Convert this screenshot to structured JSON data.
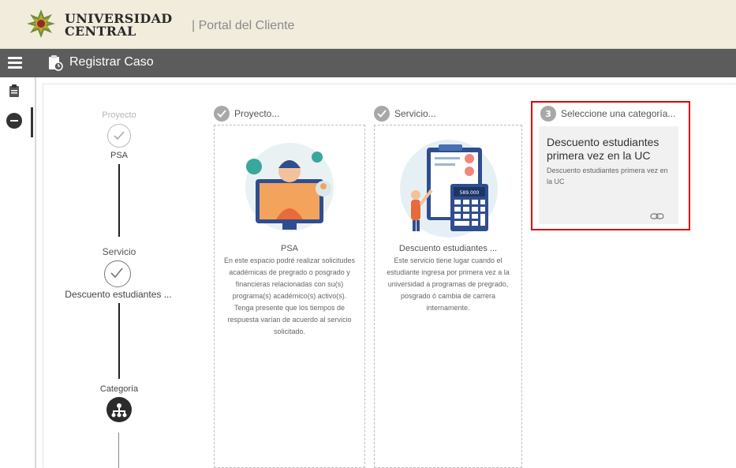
{
  "header": {
    "logo_line1": "UNIVERSIDAD",
    "logo_line2": "CENTRAL",
    "portal_title": "| Portal del Cliente"
  },
  "toolbar": {
    "title": "Registrar Caso"
  },
  "stepper": {
    "step1_label": "Proyecto",
    "step1_value": "PSA",
    "step2_label": "Servicio",
    "step2_value": "Descuento estudiantes ...",
    "step3_label": "Categoría"
  },
  "columns": {
    "proyecto": {
      "header": "Proyecto...",
      "title": "PSA",
      "desc": "En este espacio podré realizar solicitudes académicas de pregrado o posgrado y financieras relacionadas con su(s) programa(s) académico(s) activo(s). Tenga presente que los tiempos de respuesta varían de acuerdo al servicio solicitado."
    },
    "servicio": {
      "header": "Servicio...",
      "title": "Descuento estudiantes ...",
      "desc": "Este servicio tiene lugar cuando el estudiante ingresa por primera vez a la universidad a programas de pregrado, posgrado ó cambia de carrera internamente.",
      "illustration_amount": "589.000"
    },
    "categoria": {
      "number": "3",
      "header": "Seleccione una categoría...",
      "card_title": "Descuento estudiantes primera vez en la UC",
      "card_desc": "Descuento estudiantes primera vez en la UC"
    }
  },
  "colors": {
    "header_bg": "#f2ecdd",
    "toolbar_bg": "#5c5c5c",
    "highlight": "#e00000"
  }
}
